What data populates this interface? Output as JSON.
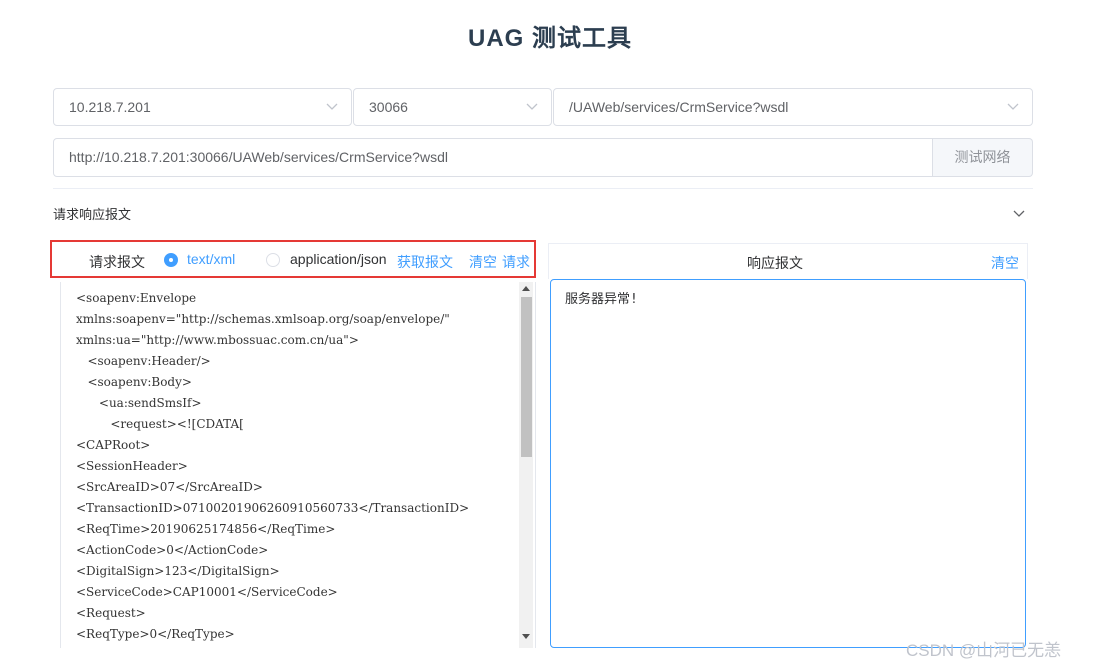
{
  "page": {
    "title": "UAG 测试工具"
  },
  "selects": {
    "host": "10.218.7.201",
    "port": "30066",
    "service": "/UAWeb/services/CrmService?wsdl"
  },
  "url": {
    "value": "http://10.218.7.201:30066/UAWeb/services/CrmService?wsdl",
    "button": "测试网络"
  },
  "collapse": {
    "title": "请求响应报文"
  },
  "request": {
    "label": "请求报文",
    "format_options": [
      "text/xml",
      "application/json"
    ],
    "selected_format": "text/xml",
    "links": {
      "fetch": "获取报文",
      "clear": "清空",
      "send": "请求"
    },
    "body_lines": [
      "<soapenv:Envelope",
      "xmlns:soapenv=\"http://schemas.xmlsoap.org/soap/envelope/\"",
      "xmlns:ua=\"http://www.mbossuac.com.cn/ua\">",
      "   <soapenv:Header/>",
      "   <soapenv:Body>",
      "      <ua:sendSmsIf>",
      "         <request><![CDATA[",
      "<CAPRoot>",
      "<SessionHeader>",
      "<SrcAreaID>07</SrcAreaID>",
      "<TransactionID>0710020190626091056073​3</TransactionID>",
      "<ReqTime>20190625174856</ReqTime>",
      "<ActionCode>0</ActionCode>",
      "<DigitalSign>123</DigitalSign>",
      "<ServiceCode>CAP10001</ServiceCode>",
      "<Request>",
      "<ReqType>0</ReqType>"
    ]
  },
  "response": {
    "label": "响应报文",
    "clear": "清空",
    "body": "服务器异常!"
  },
  "watermark": "CSDN @山河已无恙",
  "colors": {
    "accent": "#409eff",
    "highlight_border": "#e53935"
  }
}
